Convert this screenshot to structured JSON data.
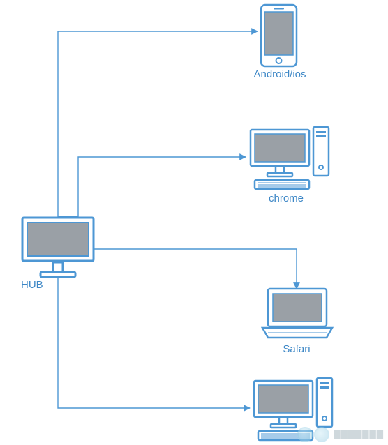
{
  "hub": {
    "label": "HUB"
  },
  "nodes": {
    "mobile": {
      "label": "Android/ios"
    },
    "desktop_chrome": {
      "label": "chrome"
    },
    "laptop_safari": {
      "label": "Safari"
    },
    "desktop_4": {
      "label": ""
    }
  },
  "colors": {
    "line": "#4d97d4",
    "screen": "#9aa0a6",
    "label": "#3d87c6"
  }
}
